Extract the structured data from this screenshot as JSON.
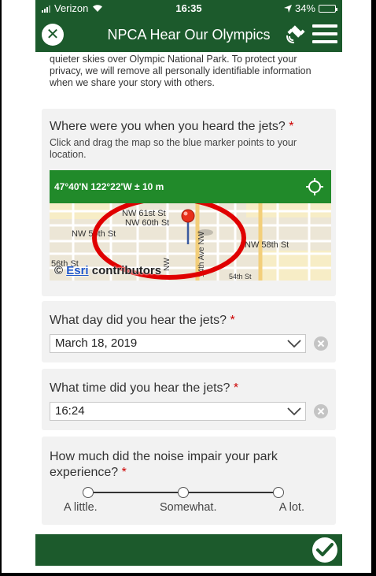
{
  "status": {
    "carrier": "Verizon",
    "time": "16:35",
    "battery": "34%",
    "battery_level": 0.34
  },
  "header": {
    "title": "NPCA Hear Our Olympics"
  },
  "intro": {
    "text": "quieter skies over Olympic National Park. To protect your privacy, we will remove all personally identifiable information when we share your story with others."
  },
  "location": {
    "question": "Where were you when you heard the jets?",
    "hint": "Click and drag the map so the blue marker points to your location.",
    "coords": "47°40'N 122°22'W ± 10 m",
    "streets": [
      "NW 61st St",
      "NW 60th St",
      "NW 59th St",
      "NW 58th St",
      "56th St",
      "14th Ave NW",
      "NW",
      "54th St"
    ],
    "attribution_prefix": "© ",
    "attribution_link": "Esri",
    "attribution_suffix": " contributors"
  },
  "day": {
    "question": "What day did you hear the jets?",
    "value": "March 18, 2019"
  },
  "time": {
    "question": "What time did you hear the jets?",
    "value": "16:24"
  },
  "impair": {
    "question": "How much did the noise impair your park experience?",
    "options": [
      "A little.",
      "Somewhat.",
      "A lot."
    ]
  },
  "required_mark": "*",
  "colors": {
    "header_green": "#1c5a2c",
    "map_bar": "#218a2a",
    "marker": "#e8301c",
    "annotation": "#e00000"
  }
}
